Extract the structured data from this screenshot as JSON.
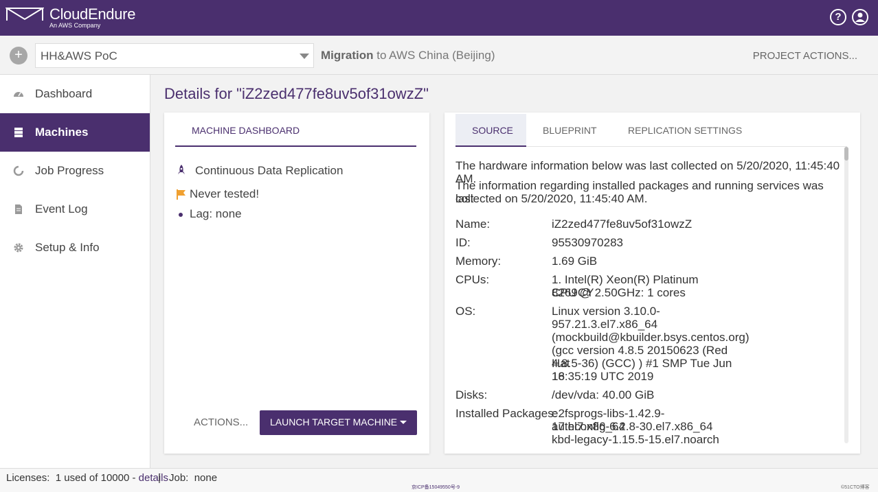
{
  "brand": {
    "name": "CloudEndure",
    "tagline": "An AWS Company"
  },
  "topbar": {
    "help_icon": "help-circle-icon",
    "user_icon": "user-circle-icon"
  },
  "project_bar": {
    "add_icon": "plus-icon",
    "project_name": "HH&AWS PoC",
    "migration_label": "Migration",
    "migration_rest": " to AWS China (Beijing)",
    "actions_label": "PROJECT ACTIONS..."
  },
  "sidebar": {
    "items": [
      {
        "label": "Dashboard",
        "icon": "speedometer-icon",
        "active": false
      },
      {
        "label": "Machines",
        "icon": "server-icon",
        "active": true
      },
      {
        "label": "Job Progress",
        "icon": "progress-icon",
        "active": false
      },
      {
        "label": "Event Log",
        "icon": "document-icon",
        "active": false
      },
      {
        "label": "Setup & Info",
        "icon": "gear-icon",
        "active": false
      }
    ]
  },
  "page_title": "Details for \"iZ2zed477fe8uv5of31owzZ\"",
  "machine_dashboard": {
    "tab_label": "MACHINE DASHBOARD",
    "replication_status": "Continuous Data Replication",
    "test_status": "Never tested!",
    "lag": "Lag: none",
    "actions_label": "ACTIONS...",
    "launch_label": "LAUNCH TARGET MACHINE",
    "accent_color": "#4a2f6e",
    "flag_color": "#f0a030"
  },
  "details_panel": {
    "tabs": [
      {
        "label": "SOURCE",
        "active": true
      },
      {
        "label": "BLUEPRINT",
        "active": false
      },
      {
        "label": "REPLICATION SETTINGS",
        "active": false
      }
    ],
    "hw_note": "The hardware information below was last collected on 5/20/2020, 11:45:40 AM.",
    "pkg_note_line1": "The information regarding installed packages and running services was last",
    "pkg_note_line2": "collected on 5/20/2020, 11:45:40 AM.",
    "fields": {
      "name_key": "Name:",
      "name_val": "iZ2zed477fe8uv5of31owzZ",
      "id_key": "ID:",
      "id_val": "95530970283",
      "memory_key": "Memory:",
      "memory_val": "1.69 GiB",
      "cpus_key": "CPUs:",
      "cpus_val_1": "1. Intel(R) Xeon(R) Platinum 8269CY",
      "cpus_val_2": "CPU @ 2.50GHz: 1 cores",
      "os_key": "OS:",
      "os_val_1": "Linux version 3.10.0-",
      "os_val_2": "957.21.3.el7.x86_64",
      "os_val_3": "(mockbuild@kbuilder.bsys.centos.org)",
      "os_val_4": "(gcc version 4.8.5 20150623 (Red Hat",
      "os_val_5": "4.8.5-36) (GCC) ) #1 SMP Tue Jun 18",
      "os_val_6": "16:35:19 UTC 2019",
      "disks_key": "Disks:",
      "disks_val": "/dev/vda: 40.00 GiB",
      "packages_key": "Installed Packages:",
      "packages": [
        "e2fsprogs-libs-1.42.9-17.el7.x86_64",
        "authconfig-6.2.8-30.el7.x86_64",
        "kbd-legacy-1.15.5-15.el7.noarch"
      ]
    }
  },
  "footer": {
    "licenses_label": "Licenses:",
    "licenses_value": "1 used of 10000 - ",
    "details_link": "details",
    "separator": "|",
    "job_label": "Job:",
    "job_value": "none",
    "icp": "京ICP备15049550号-9",
    "watermark": "©51CTO博客"
  }
}
